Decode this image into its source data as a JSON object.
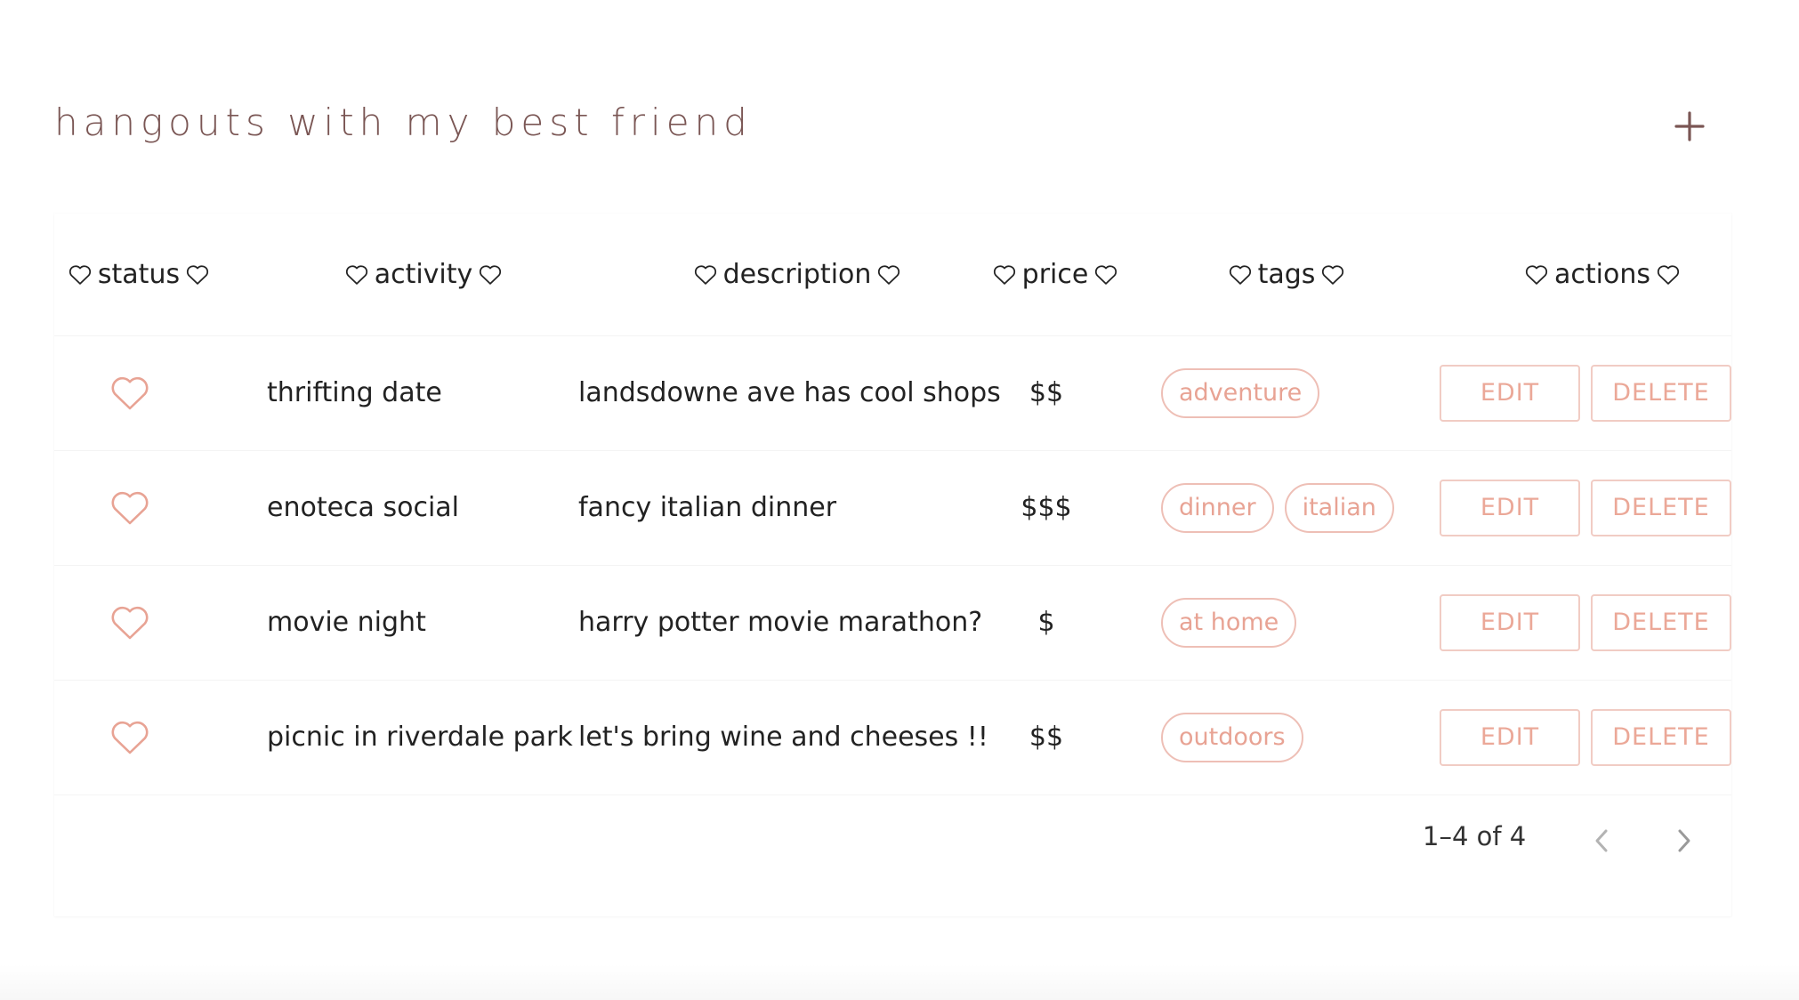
{
  "page": {
    "title": "hangouts with my best friend",
    "add_icon": "plus-icon"
  },
  "colors": {
    "title": "#7a5654",
    "accent": "#e8a394",
    "accent_border": "#eebfb6",
    "text": "#222222"
  },
  "table": {
    "header_icon": "heart-outline-icon",
    "columns": [
      "status",
      "activity",
      "description",
      "price",
      "tags",
      "actions"
    ],
    "rows": [
      {
        "status_icon": "heart-outline-icon",
        "activity": "thrifting date",
        "description": "landsdowne ave has cool shops",
        "price": "$$",
        "tags": [
          "adventure"
        ],
        "edit_label": "EDIT",
        "delete_label": "DELETE"
      },
      {
        "status_icon": "heart-outline-icon",
        "activity": "enoteca social",
        "description": "fancy italian dinner",
        "price": "$$$",
        "tags": [
          "dinner",
          "italian"
        ],
        "edit_label": "EDIT",
        "delete_label": "DELETE"
      },
      {
        "status_icon": "heart-outline-icon",
        "activity": "movie night",
        "description": "harry potter movie marathon?",
        "price": "$",
        "tags": [
          "at home"
        ],
        "edit_label": "EDIT",
        "delete_label": "DELETE"
      },
      {
        "status_icon": "heart-outline-icon",
        "activity": "picnic in riverdale park",
        "description": "let's bring wine and cheeses !!",
        "price": "$$",
        "tags": [
          "outdoors"
        ],
        "edit_label": "EDIT",
        "delete_label": "DELETE"
      }
    ]
  },
  "pagination": {
    "range_text": "1–4 of 4",
    "prev_icon": "chevron-left-icon",
    "next_icon": "chevron-right-icon"
  }
}
